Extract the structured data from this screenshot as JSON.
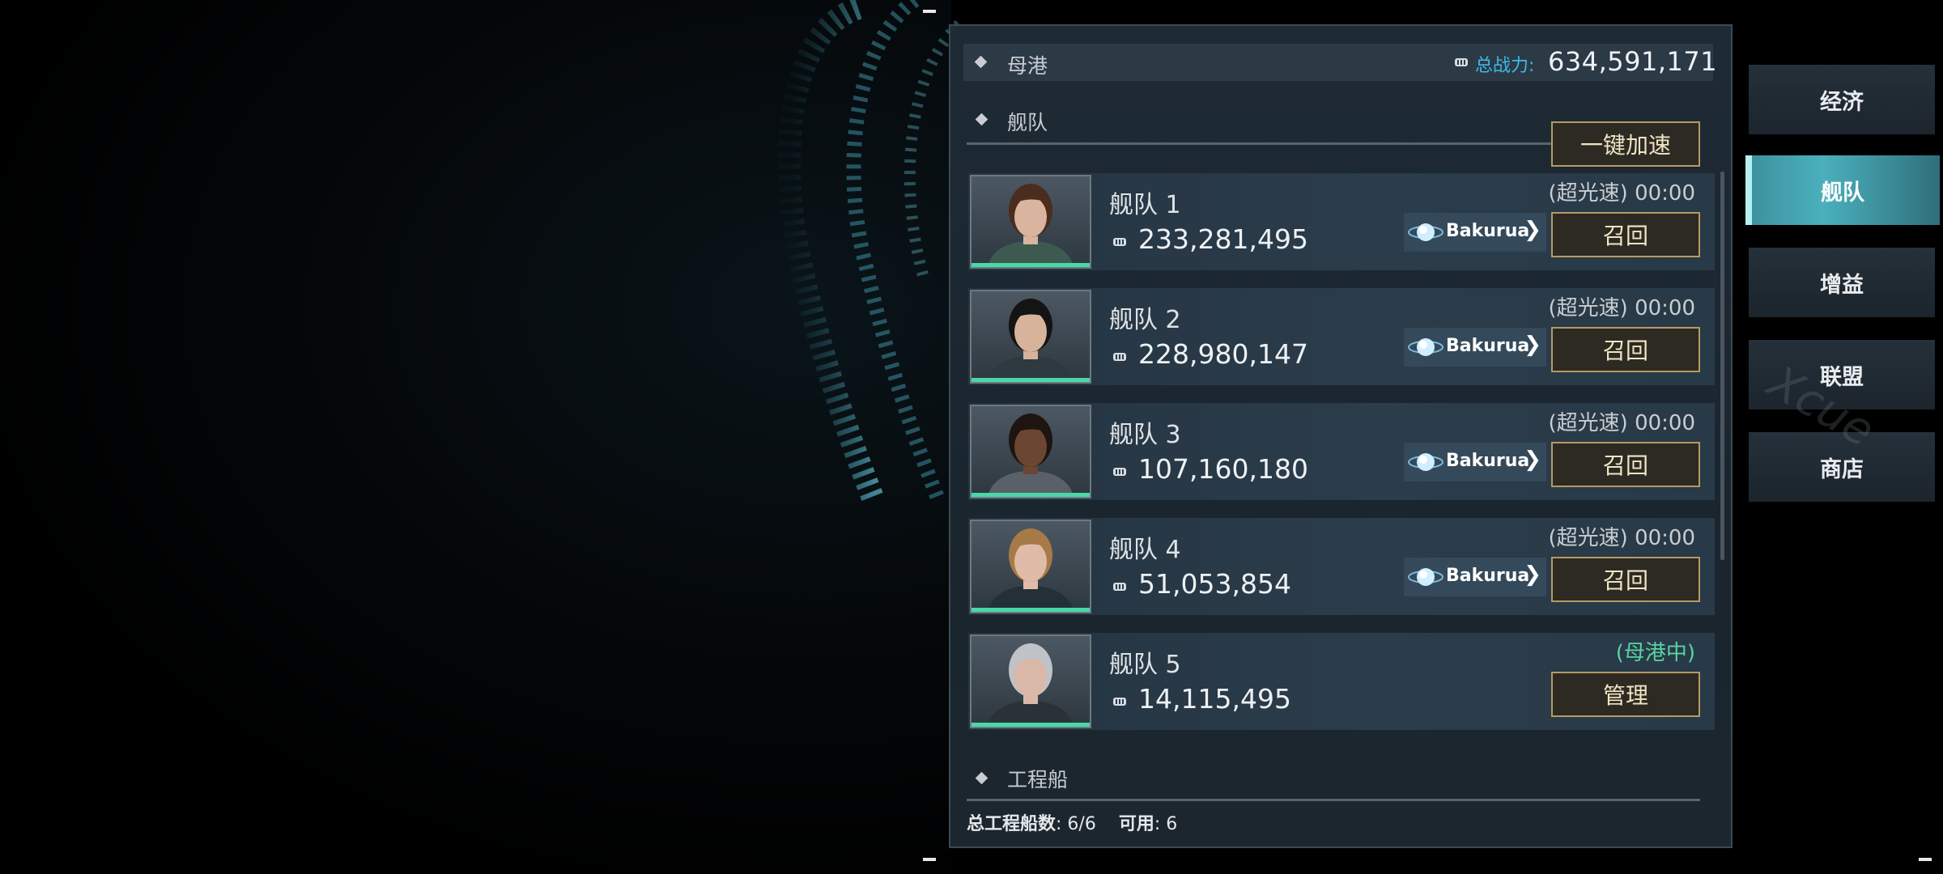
{
  "home_section": {
    "title": "母港",
    "total_power_label": "总战力:",
    "total_power_value": "634,591,171",
    "power_icon": "fist-icon"
  },
  "fleet_section": {
    "title": "舰队",
    "speedup_all_label": "一键加速"
  },
  "fleets": [
    {
      "name": "舰队 1",
      "power": "233,281,495",
      "status": "(超光速) 00:00",
      "planet": "Bakurua",
      "action": "召回",
      "portrait": "female-short-brown-hair"
    },
    {
      "name": "舰队 2",
      "power": "228,980,147",
      "status": "(超光速) 00:00",
      "planet": "Bakurua",
      "action": "召回",
      "portrait": "female-black-ponytail"
    },
    {
      "name": "舰队 3",
      "power": "107,160,180",
      "status": "(超光速) 00:00",
      "planet": "Bakurua",
      "action": "召回",
      "portrait": "male-dark-skin"
    },
    {
      "name": "舰队 4",
      "power": "51,053,854",
      "status": "(超光速) 00:00",
      "planet": "Bakurua",
      "action": "召回",
      "portrait": "female-blonde-bob"
    },
    {
      "name": "舰队 5",
      "power": "14,115,495",
      "status": "(母港中)",
      "planet": "",
      "action": "管理",
      "portrait": "female-gray-hair"
    }
  ],
  "engineer_section": {
    "title": "工程船",
    "total_label": "总工程船数",
    "total_value": ": 6/6",
    "available_label": "可用",
    "available_value": ": 6"
  },
  "nav": {
    "items": [
      "经济",
      "舰队",
      "增益",
      "联盟",
      "商店"
    ],
    "active": "舰队"
  },
  "colors": {
    "accent_cyan": "#3db9e8",
    "gold_border": "#b59a63",
    "hp_green": "#49d9a8",
    "home_green": "#59d3a2",
    "nav_active": "#4ab0bc"
  }
}
